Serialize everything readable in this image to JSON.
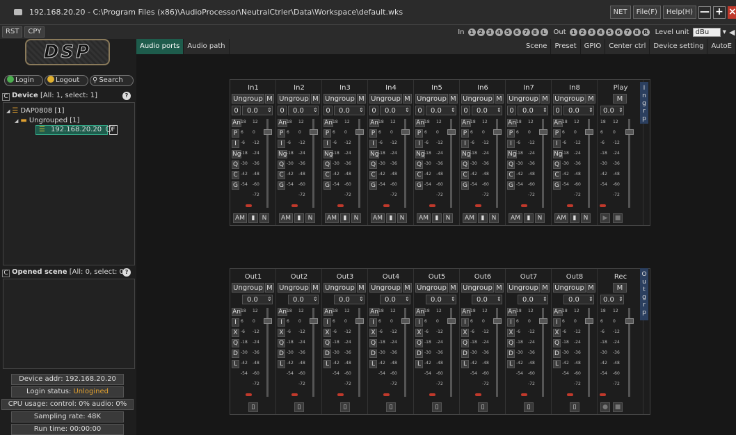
{
  "titlebar": {
    "title": "192.168.20.20 - C:\\Program Files (x86)\\AudioProcessor\\NeutralCtrler\\Data\\Workspace\\default.wks",
    "buttons": [
      "NET",
      "File(F)",
      "Help(H)"
    ],
    "minimize": "—",
    "maximize": "+",
    "close": "×"
  },
  "toolbar": {
    "rst": "RST",
    "cpy": "CPY",
    "in_label": "In",
    "in_channels": [
      "1",
      "2",
      "3",
      "4",
      "5",
      "6",
      "7",
      "8",
      "L"
    ],
    "out_label": "Out",
    "out_channels": [
      "1",
      "2",
      "3",
      "4",
      "5",
      "6",
      "7",
      "8",
      "R"
    ],
    "level_unit_label": "Level unit",
    "level_unit_value": "dBu"
  },
  "left": {
    "logo": "DSP",
    "login": "Login",
    "logout": "Logout",
    "search": "Search",
    "device_header": "Device",
    "device_count": "[All: 1, select: 1]",
    "tree": {
      "device": "DAP0808 [1]",
      "group": "Ungrouped [1]",
      "ip": "192.168.20.20",
      "flag": "F"
    },
    "scene_header": "Opened scene",
    "scene_count": "[All: 0, select: 0]",
    "status": [
      "Device addr: 192.168.20.20",
      "Login status: Unlogined",
      "CPU usage: control: 0%  audio: 0%",
      "Sampling rate: 48K",
      "Run time: 00:00:00"
    ],
    "login_status_label": "Login status: ",
    "login_status_value": "Unlogined"
  },
  "tabs": {
    "left": [
      "Audio ports",
      "Audio path"
    ],
    "right": [
      "Scene",
      "Preset",
      "GPIO",
      "Center ctrl",
      "Device setting",
      "AutoE"
    ]
  },
  "inputs": {
    "channels": [
      "In1",
      "In2",
      "In3",
      "In4",
      "In5",
      "In6",
      "In7",
      "In8"
    ],
    "play": "Play",
    "side": [
      "I",
      "n",
      "g",
      "r",
      "p"
    ],
    "ungroup": "Ungroup",
    "m": "M",
    "phase": "0",
    "gain": "0.0",
    "buttons": [
      "An",
      "P",
      "I",
      "Ng",
      "Q",
      "C",
      "G"
    ],
    "am": "AM",
    "n": "N"
  },
  "outputs": {
    "channels": [
      "Out1",
      "Out2",
      "Out3",
      "Out4",
      "Out5",
      "Out6",
      "Out7",
      "Out8"
    ],
    "rec": "Rec",
    "side": [
      "O",
      "u",
      "t",
      "g",
      "r",
      "p"
    ],
    "buttons": [
      "An",
      "I",
      "X",
      "Q",
      "D",
      "L"
    ]
  },
  "scale": {
    "left": [
      "18",
      "6",
      "-6",
      "-18",
      "-30",
      "-42",
      "-54"
    ],
    "right": [
      "12",
      "0",
      "-12",
      "-24",
      "-36",
      "-48",
      "-60",
      "-72"
    ]
  },
  "colors": {
    "tab_active": "#1e5c4c",
    "side_label_bg": "#2b3f5f",
    "close": "#c0392b",
    "unlogined": "#e0a030"
  }
}
